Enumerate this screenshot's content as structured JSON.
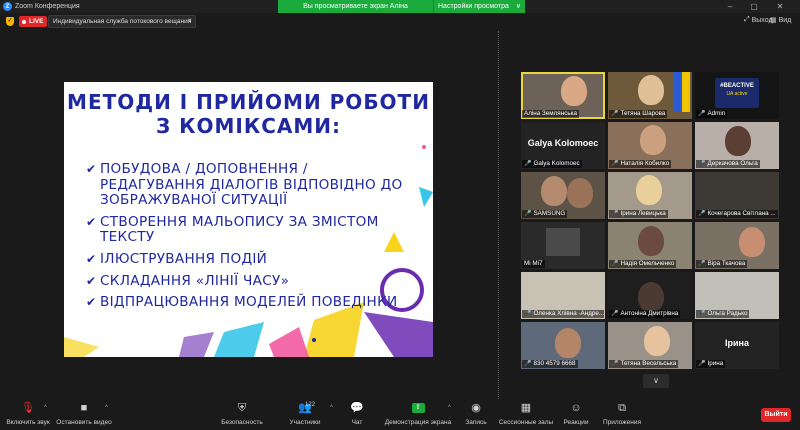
{
  "app": {
    "title": "Zoom Конференция",
    "logo_letter": "Z"
  },
  "window_controls": {
    "minimize": "–",
    "maximize": "▢",
    "close": "✕"
  },
  "share_banner": {
    "text": "Вы просматриваете экран Аліна Землянська",
    "view_options": "Настройки просмотра",
    "caret": "∨"
  },
  "top_controls": {
    "live": "LIVE",
    "stream_service": "Индивидуальная служба потокового вещания",
    "caret": "∨",
    "exit_fullscreen": "Выход",
    "view": "Вид"
  },
  "slide": {
    "title_line1": "МЕТОДИ І ПРИЙОМИ РОБОТИ",
    "title_line2": "З КОМІКСАМИ:",
    "check": "✔",
    "bullets": [
      "ПОБУДОВА / ДОПОВНЕННЯ / РЕДАГУВАННЯ ДІАЛОГІВ ВІДПОВІДНО ДО ЗОБРАЖУВАНОЇ СИТУАЦІЇ",
      "СТВОРЕННЯ МАЛЬОПИСУ ЗА ЗМІСТОМ ТЕКСТУ",
      "ІЛЮСТРУВАННЯ ПОДІЙ",
      "СКЛАДАННЯ «ЛІНІЇ ЧАСУ»",
      "ВІДПРАЦЮВАННЯ МОДЕЛЕЙ ПОВЕДІНКИ"
    ],
    "accent_colors": {
      "text": "#1f28a0",
      "purple": "#6a2bb0",
      "yellow": "#f7d31c",
      "pink": "#f25aa0",
      "cyan": "#38c6e8"
    }
  },
  "participants": [
    {
      "name": "Аліна Землянська",
      "muted": false,
      "active": true
    },
    {
      "name": "Тетяна Шарова",
      "muted": true
    },
    {
      "name": "Admin",
      "muted": true
    },
    {
      "name": "Galya Kolomoec",
      "muted": false
    },
    {
      "name": "Наталія Кобилко",
      "muted": true
    },
    {
      "name": "Деркачова Ольга",
      "muted": true
    },
    {
      "name": "SAMSUNG",
      "muted": true
    },
    {
      "name": "Ірина Левицька",
      "muted": true
    },
    {
      "name": "Кочегарова Світлана ...",
      "muted": true
    },
    {
      "name": "Mi Mi7",
      "muted": false
    },
    {
      "name": "Надія Омельченко",
      "muted": true
    },
    {
      "name": "Віра Ткачова",
      "muted": true
    },
    {
      "name": "Оленка Хлівна -Андре...",
      "muted": true
    },
    {
      "name": "Антоніна Дмитрівна",
      "muted": true
    },
    {
      "name": "Ольга Радько",
      "muted": true
    },
    {
      "name": "830 4579 6668",
      "muted": true
    },
    {
      "name": "Тетяна Весельська",
      "muted": true
    },
    {
      "name": "Ірина",
      "muted": true
    }
  ],
  "tile_labels": {
    "galya": "Galya Kolomoec",
    "irina": "Ірина",
    "admin_logo1": "#BEACTIVE",
    "admin_logo2": "UA active"
  },
  "gallery_scroll": "∨",
  "toolbar": {
    "mute": "Включить звук",
    "video": "Остановить видео",
    "security": "Безопасность",
    "participants": "Участники",
    "participants_count": "122",
    "chat": "Чат",
    "share": "Демонстрация экрана",
    "record": "Запись",
    "breakout": "Сессионные залы",
    "reactions": "Реакции",
    "apps": "Приложения",
    "leave": "Выйти",
    "caret": "^"
  }
}
